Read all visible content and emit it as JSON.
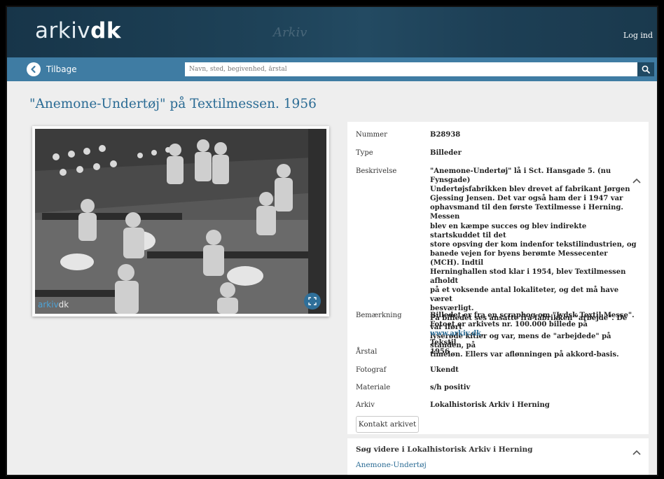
{
  "header": {
    "logo_arkiv": "arkiv",
    "logo_dk": "dk",
    "watermark": "Arkiv",
    "login_label": "Log ind"
  },
  "nav": {
    "back_label": "Tilbage",
    "search_placeholder": "Navn, sted, begivenhed, årstal"
  },
  "record": {
    "title": "\"Anemone-Undertøj\" på Textilmessen. 1956",
    "photo_caption_arkiv": "arkiv",
    "photo_caption_dk": "dk",
    "fields": [
      {
        "key": "Nummer",
        "value": "B28938"
      },
      {
        "key": "Type",
        "value": "Billeder"
      },
      {
        "key": "Beskrivelse",
        "lines": [
          "\"Anemone-Undertøj\" lå i Sct. Hansgade 5. (nu Fynsgade)",
          "Undertøjsfabrikken blev drevet af fabrikant Jørgen",
          "Gjessing Jensen. Det var også ham der i 1947 var",
          "ophavsmand til den første Textilmesse i Herning. Messen",
          "blev en kæmpe succes og blev indirekte startskuddet til det",
          "store opsving der kom indenfor tekstilindustrien, og",
          "banede vejen for byens berømte Messecenter (MCH). Indtil",
          "Herninghallen stod klar i 1954, blev Textilmessen afholdt",
          "på et voksende antal lokaliteter, og det må have været",
          "besværligt.",
          "På billedet ses ansatte fra fabrikken \"arbejde\". De var iført",
          "lyserøde kitler og var, mens de \"arbejdede\" på standen, på",
          "timeløn. Ellers var aflønningen på akkord-basis."
        ]
      },
      {
        "key": "Bemærkning",
        "line1": "Billedet er fra en scrapbog om \"Jydsk Textil Messe\".",
        "line2_text": "Fotoet er arkivets nr. 100.000 billede på ",
        "line2_link": "www.arkiv.dk",
        "line2_end": ".",
        "line3": "Tekstil"
      },
      {
        "key": "Årstal",
        "value": "1956"
      },
      {
        "key": "Fotograf",
        "value": "Ukendt"
      },
      {
        "key": "Materiale",
        "value": "s/h positiv"
      },
      {
        "key": "Arkiv",
        "value": "Lokalhistorisk Arkiv i Herning"
      }
    ],
    "contact_button": "Kontakt arkivet"
  },
  "further": {
    "title": "Søg videre i Lokalhistorisk Arkiv i Herning",
    "link": "Anemone-Undertøj"
  },
  "colors": {
    "header_bg": "#1e4258",
    "nav_bg": "#3f7ca3",
    "title": "#2a6b94",
    "link": "#2a6b94",
    "page_bg": "#eeeeee"
  }
}
